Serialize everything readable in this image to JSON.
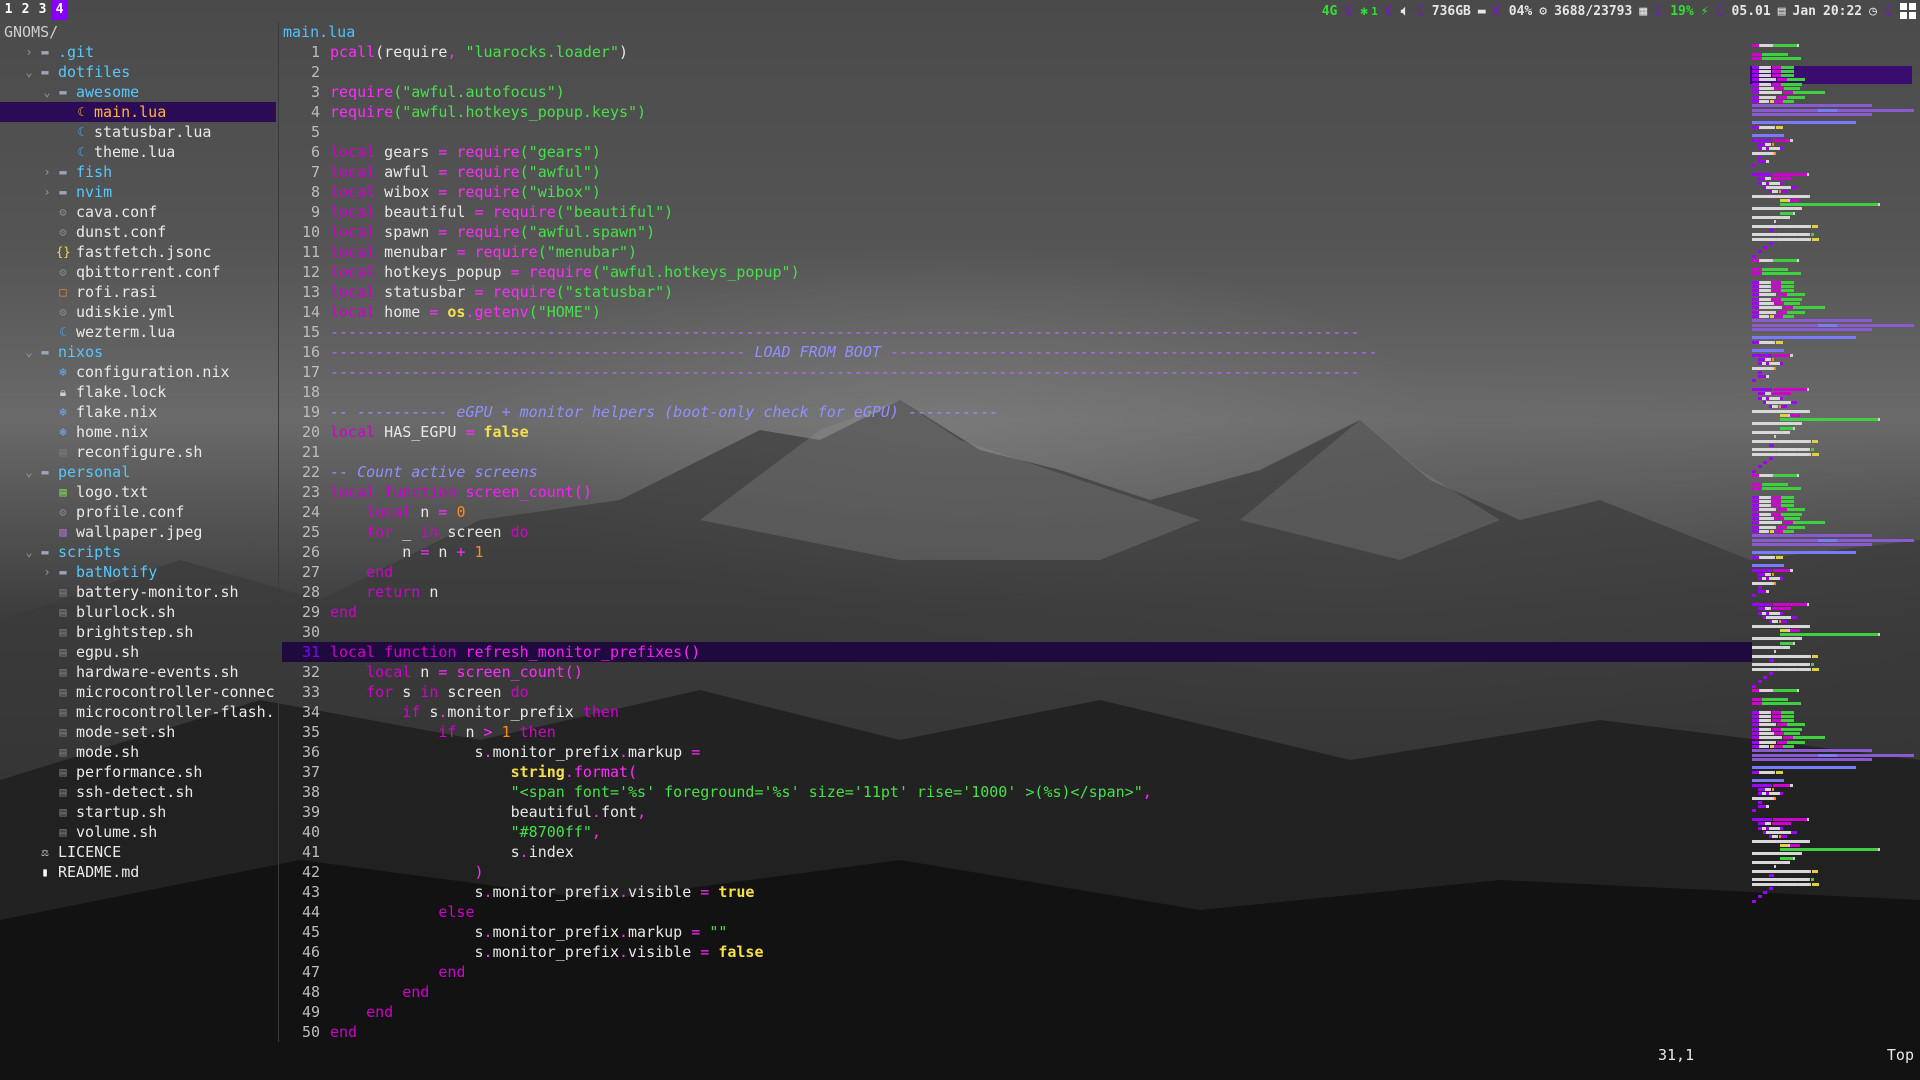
{
  "workspaces": [
    {
      "label": "1",
      "active": false
    },
    {
      "label": "2",
      "active": false
    },
    {
      "label": "3",
      "active": false
    },
    {
      "label": "4",
      "active": true
    }
  ],
  "statusbar": {
    "network": "4G",
    "bluetooth_count": "1",
    "disk": "736GB",
    "cpu": "04%",
    "memory": "3688/23793",
    "battery": "19%",
    "date": "05.01",
    "day": "Jan",
    "time": "20:22"
  },
  "file_tree": {
    "root": "GNOMS/",
    "items": [
      {
        "name": ".git",
        "depth": 1,
        "kind": "dir",
        "open": false,
        "icon": "folder-icon"
      },
      {
        "name": "dotfiles",
        "depth": 1,
        "kind": "dir",
        "open": true,
        "icon": "folder-icon"
      },
      {
        "name": "awesome",
        "depth": 2,
        "kind": "dir",
        "open": true,
        "icon": "folder-icon"
      },
      {
        "name": "main.lua",
        "depth": 3,
        "kind": "file",
        "icon": "lua-icon",
        "color": "#ffb63b",
        "selected": true
      },
      {
        "name": "statusbar.lua",
        "depth": 3,
        "kind": "file",
        "icon": "lua-icon",
        "color": "#4aa8ff"
      },
      {
        "name": "theme.lua",
        "depth": 3,
        "kind": "file",
        "icon": "lua-icon",
        "color": "#4aa8ff"
      },
      {
        "name": "fish",
        "depth": 2,
        "kind": "dir",
        "open": false,
        "icon": "folder-icon"
      },
      {
        "name": "nvim",
        "depth": 2,
        "kind": "dir",
        "open": false,
        "icon": "folder-icon"
      },
      {
        "name": "cava.conf",
        "depth": 2,
        "kind": "file",
        "icon": "gear-icon",
        "color": "#8a8a8a"
      },
      {
        "name": "dunst.conf",
        "depth": 2,
        "kind": "file",
        "icon": "gear-icon",
        "color": "#8a8a8a"
      },
      {
        "name": "fastfetch.jsonc",
        "depth": 2,
        "kind": "file",
        "icon": "json-icon",
        "color": "#f4e04a"
      },
      {
        "name": "qbittorrent.conf",
        "depth": 2,
        "kind": "file",
        "icon": "gear-icon",
        "color": "#8a8a8a"
      },
      {
        "name": "rofi.rasi",
        "depth": 2,
        "kind": "file",
        "icon": "square-icon",
        "color": "#e08040"
      },
      {
        "name": "udiskie.yml",
        "depth": 2,
        "kind": "file",
        "icon": "gear-icon",
        "color": "#8a8a8a"
      },
      {
        "name": "wezterm.lua",
        "depth": 2,
        "kind": "file",
        "icon": "lua-icon",
        "color": "#4aa8ff"
      },
      {
        "name": "nixos",
        "depth": 1,
        "kind": "dir",
        "open": true,
        "icon": "folder-icon"
      },
      {
        "name": "configuration.nix",
        "depth": 2,
        "kind": "file",
        "icon": "nix-icon",
        "color": "#6fa8ff"
      },
      {
        "name": "flake.lock",
        "depth": 2,
        "kind": "file",
        "icon": "lock-icon",
        "color": "#cfcfcf"
      },
      {
        "name": "flake.nix",
        "depth": 2,
        "kind": "file",
        "icon": "nix-icon",
        "color": "#6fa8ff"
      },
      {
        "name": "home.nix",
        "depth": 2,
        "kind": "file",
        "icon": "nix-icon",
        "color": "#6fa8ff"
      },
      {
        "name": "reconfigure.sh",
        "depth": 2,
        "kind": "file",
        "icon": "terminal-icon",
        "color": "#7a7a7a"
      },
      {
        "name": "personal",
        "depth": 1,
        "kind": "dir",
        "open": true,
        "icon": "folder-icon"
      },
      {
        "name": "logo.txt",
        "depth": 2,
        "kind": "file",
        "icon": "text-file-icon",
        "color": "#7ed957"
      },
      {
        "name": "profile.conf",
        "depth": 2,
        "kind": "file",
        "icon": "gear-icon",
        "color": "#8a8a8a"
      },
      {
        "name": "wallpaper.jpeg",
        "depth": 2,
        "kind": "file",
        "icon": "image-icon",
        "color": "#b070d0"
      },
      {
        "name": "scripts",
        "depth": 1,
        "kind": "dir",
        "open": true,
        "icon": "folder-icon"
      },
      {
        "name": "batNotify",
        "depth": 2,
        "kind": "dir",
        "open": false,
        "icon": "folder-icon"
      },
      {
        "name": "battery-monitor.sh",
        "depth": 2,
        "kind": "file",
        "icon": "terminal-icon",
        "color": "#7a7a7a"
      },
      {
        "name": "blurlock.sh",
        "depth": 2,
        "kind": "file",
        "icon": "terminal-icon",
        "color": "#7a7a7a"
      },
      {
        "name": "brightstep.sh",
        "depth": 2,
        "kind": "file",
        "icon": "terminal-icon",
        "color": "#7a7a7a"
      },
      {
        "name": "egpu.sh",
        "depth": 2,
        "kind": "file",
        "icon": "terminal-icon",
        "color": "#7a7a7a"
      },
      {
        "name": "hardware-events.sh",
        "depth": 2,
        "kind": "file",
        "icon": "terminal-icon",
        "color": "#7a7a7a"
      },
      {
        "name": "microcontroller-connec",
        "depth": 2,
        "kind": "file",
        "icon": "terminal-icon",
        "color": "#7a7a7a"
      },
      {
        "name": "microcontroller-flash.",
        "depth": 2,
        "kind": "file",
        "icon": "terminal-icon",
        "color": "#7a7a7a"
      },
      {
        "name": "mode-set.sh",
        "depth": 2,
        "kind": "file",
        "icon": "terminal-icon",
        "color": "#7a7a7a"
      },
      {
        "name": "mode.sh",
        "depth": 2,
        "kind": "file",
        "icon": "terminal-icon",
        "color": "#7a7a7a"
      },
      {
        "name": "performance.sh",
        "depth": 2,
        "kind": "file",
        "icon": "terminal-icon",
        "color": "#7a7a7a"
      },
      {
        "name": "ssh-detect.sh",
        "depth": 2,
        "kind": "file",
        "icon": "terminal-icon",
        "color": "#7a7a7a"
      },
      {
        "name": "startup.sh",
        "depth": 2,
        "kind": "file",
        "icon": "terminal-icon",
        "color": "#7a7a7a"
      },
      {
        "name": "volume.sh",
        "depth": 2,
        "kind": "file",
        "icon": "terminal-icon",
        "color": "#7a7a7a"
      },
      {
        "name": "LICENCE",
        "depth": 1,
        "kind": "file",
        "icon": "license-icon",
        "color": "#cfcfcf"
      },
      {
        "name": "README.md",
        "depth": 1,
        "kind": "file",
        "icon": "markdown-icon",
        "color": "#ffffff"
      }
    ]
  },
  "editor": {
    "filename": "main.lua",
    "current_line": 31,
    "cursor_position": "31,1",
    "scroll_position": "Top",
    "lines": [
      [
        [
          "f",
          "pcall"
        ],
        [
          "v",
          "(require"
        ],
        [
          "o",
          ", "
        ],
        [
          "s",
          "\"luarocks.loader\""
        ],
        [
          "v",
          ")"
        ]
      ],
      [],
      [
        [
          "f",
          "require"
        ],
        [
          "s",
          "(\"awful.autofocus\")"
        ]
      ],
      [
        [
          "f",
          "require"
        ],
        [
          "s",
          "(\"awful.hotkeys_popup.keys\")"
        ]
      ],
      [],
      [
        [
          "k",
          "local"
        ],
        [
          "v",
          " gears "
        ],
        [
          "o",
          "="
        ],
        [
          "v",
          " "
        ],
        [
          "f",
          "require"
        ],
        [
          "s",
          "(\"gears\")"
        ]
      ],
      [
        [
          "k",
          "local"
        ],
        [
          "v",
          " awful "
        ],
        [
          "o",
          "="
        ],
        [
          "v",
          " "
        ],
        [
          "f",
          "require"
        ],
        [
          "s",
          "(\"awful\")"
        ]
      ],
      [
        [
          "k",
          "local"
        ],
        [
          "v",
          " wibox "
        ],
        [
          "o",
          "="
        ],
        [
          "v",
          " "
        ],
        [
          "f",
          "require"
        ],
        [
          "s",
          "(\"wibox\")"
        ]
      ],
      [
        [
          "k",
          "local"
        ],
        [
          "v",
          " beautiful "
        ],
        [
          "o",
          "="
        ],
        [
          "v",
          " "
        ],
        [
          "f",
          "require"
        ],
        [
          "s",
          "(\"beautiful\")"
        ]
      ],
      [
        [
          "k",
          "local"
        ],
        [
          "v",
          " spawn "
        ],
        [
          "o",
          "="
        ],
        [
          "v",
          " "
        ],
        [
          "f",
          "require"
        ],
        [
          "s",
          "(\"awful.spawn\")"
        ]
      ],
      [
        [
          "k",
          "local"
        ],
        [
          "v",
          " menubar "
        ],
        [
          "o",
          "="
        ],
        [
          "v",
          " "
        ],
        [
          "f",
          "require"
        ],
        [
          "s",
          "(\"menubar\")"
        ]
      ],
      [
        [
          "k",
          "local"
        ],
        [
          "v",
          " hotkeys_popup "
        ],
        [
          "o",
          "="
        ],
        [
          "v",
          " "
        ],
        [
          "f",
          "require"
        ],
        [
          "s",
          "(\"awful.hotkeys_popup\")"
        ]
      ],
      [
        [
          "k",
          "local"
        ],
        [
          "v",
          " statusbar "
        ],
        [
          "o",
          "="
        ],
        [
          "v",
          " "
        ],
        [
          "f",
          "require"
        ],
        [
          "s",
          "(\"statusbar\")"
        ]
      ],
      [
        [
          "k",
          "local"
        ],
        [
          "v",
          " home "
        ],
        [
          "o",
          "="
        ],
        [
          "v",
          " "
        ],
        [
          "bool",
          "os"
        ],
        [
          "o",
          "."
        ],
        [
          "f",
          "getenv"
        ],
        [
          "s",
          "(\"HOME\")"
        ]
      ],
      [
        [
          "dash",
          "------------------------------------------------------------------------------------------------------------------"
        ]
      ],
      [
        [
          "dash",
          "---------------------------------------------- "
        ],
        [
          "c",
          "LOAD FROM BOOT"
        ],
        [
          "dash",
          " ------------------------------------------------------"
        ]
      ],
      [
        [
          "dash",
          "------------------------------------------------------------------------------------------------------------------"
        ]
      ],
      [],
      [
        [
          "c",
          "-- ---------- eGPU + monitor helpers (boot-only check for eGPU) ----------"
        ]
      ],
      [
        [
          "k",
          "local"
        ],
        [
          "v",
          " HAS_EGPU "
        ],
        [
          "o",
          "="
        ],
        [
          "v",
          " "
        ],
        [
          "bool",
          "false"
        ]
      ],
      [],
      [
        [
          "c",
          "-- Count active screens"
        ]
      ],
      [
        [
          "k",
          "local function"
        ],
        [
          "v",
          " "
        ],
        [
          "b",
          "screen_count"
        ],
        [
          "o",
          "()"
        ]
      ],
      [
        [
          "v",
          "    "
        ],
        [
          "k",
          "local"
        ],
        [
          "v",
          " n "
        ],
        [
          "o",
          "="
        ],
        [
          "v",
          " "
        ],
        [
          "n",
          "0"
        ]
      ],
      [
        [
          "v",
          "    "
        ],
        [
          "k",
          "for"
        ],
        [
          "v",
          " _ "
        ],
        [
          "k",
          "in"
        ],
        [
          "v",
          " screen "
        ],
        [
          "k",
          "do"
        ]
      ],
      [
        [
          "v",
          "        n "
        ],
        [
          "o",
          "="
        ],
        [
          "v",
          " n "
        ],
        [
          "o",
          "+"
        ],
        [
          "v",
          " "
        ],
        [
          "n",
          "1"
        ]
      ],
      [
        [
          "v",
          "    "
        ],
        [
          "k",
          "end"
        ]
      ],
      [
        [
          "v",
          "    "
        ],
        [
          "k",
          "return"
        ],
        [
          "v",
          " n"
        ]
      ],
      [
        [
          "k",
          "end"
        ]
      ],
      [],
      [
        [
          "k",
          "local function"
        ],
        [
          "v",
          " "
        ],
        [
          "b",
          "refresh_monitor_prefixes"
        ],
        [
          "o",
          "()"
        ]
      ],
      [
        [
          "v",
          "    "
        ],
        [
          "k",
          "local"
        ],
        [
          "v",
          " n "
        ],
        [
          "o",
          "="
        ],
        [
          "v",
          " "
        ],
        [
          "f",
          "screen_count()"
        ]
      ],
      [
        [
          "v",
          "    "
        ],
        [
          "k",
          "for"
        ],
        [
          "v",
          " s "
        ],
        [
          "k",
          "in"
        ],
        [
          "v",
          " screen "
        ],
        [
          "k",
          "do"
        ]
      ],
      [
        [
          "v",
          "        "
        ],
        [
          "k",
          "if"
        ],
        [
          "v",
          " s"
        ],
        [
          "o",
          "."
        ],
        [
          "v",
          "monitor_prefix "
        ],
        [
          "k",
          "then"
        ]
      ],
      [
        [
          "v",
          "            "
        ],
        [
          "k",
          "if"
        ],
        [
          "v",
          " n "
        ],
        [
          "o",
          ">"
        ],
        [
          "v",
          " "
        ],
        [
          "n",
          "1"
        ],
        [
          "v",
          " "
        ],
        [
          "k",
          "then"
        ]
      ],
      [
        [
          "v",
          "                s"
        ],
        [
          "o",
          "."
        ],
        [
          "v",
          "monitor_prefix"
        ],
        [
          "o",
          "."
        ],
        [
          "v",
          "markup "
        ],
        [
          "o",
          "="
        ]
      ],
      [
        [
          "v",
          "                    "
        ],
        [
          "bool",
          "string"
        ],
        [
          "o",
          "."
        ],
        [
          "f",
          "format("
        ]
      ],
      [
        [
          "v",
          "                    "
        ],
        [
          "s",
          "\"<span font='%s' foreground='%s' size='11pt' rise='1000' >(%s)</span>\""
        ],
        [
          "o",
          ","
        ]
      ],
      [
        [
          "v",
          "                    beautiful"
        ],
        [
          "o",
          "."
        ],
        [
          "v",
          "font"
        ],
        [
          "o",
          ","
        ]
      ],
      [
        [
          "v",
          "                    "
        ],
        [
          "s",
          "\"#8700ff\""
        ],
        [
          "o",
          ","
        ]
      ],
      [
        [
          "v",
          "                    s"
        ],
        [
          "o",
          "."
        ],
        [
          "v",
          "index"
        ]
      ],
      [
        [
          "v",
          "                "
        ],
        [
          "o",
          ")"
        ]
      ],
      [
        [
          "v",
          "                s"
        ],
        [
          "o",
          "."
        ],
        [
          "v",
          "monitor_prefix"
        ],
        [
          "o",
          "."
        ],
        [
          "v",
          "visible "
        ],
        [
          "o",
          "="
        ],
        [
          "v",
          " "
        ],
        [
          "bool",
          "true"
        ]
      ],
      [
        [
          "v",
          "            "
        ],
        [
          "k",
          "else"
        ]
      ],
      [
        [
          "v",
          "                s"
        ],
        [
          "o",
          "."
        ],
        [
          "v",
          "monitor_prefix"
        ],
        [
          "o",
          "."
        ],
        [
          "v",
          "markup "
        ],
        [
          "o",
          "="
        ],
        [
          "v",
          " "
        ],
        [
          "s",
          "\"\""
        ]
      ],
      [
        [
          "v",
          "                s"
        ],
        [
          "o",
          "."
        ],
        [
          "v",
          "monitor_prefix"
        ],
        [
          "o",
          "."
        ],
        [
          "v",
          "visible "
        ],
        [
          "o",
          "="
        ],
        [
          "v",
          " "
        ],
        [
          "bool",
          "false"
        ]
      ],
      [
        [
          "v",
          "            "
        ],
        [
          "k",
          "end"
        ]
      ],
      [
        [
          "v",
          "        "
        ],
        [
          "k",
          "end"
        ]
      ],
      [
        [
          "v",
          "    "
        ],
        [
          "k",
          "end"
        ]
      ],
      [
        [
          "k",
          "end"
        ]
      ]
    ]
  }
}
